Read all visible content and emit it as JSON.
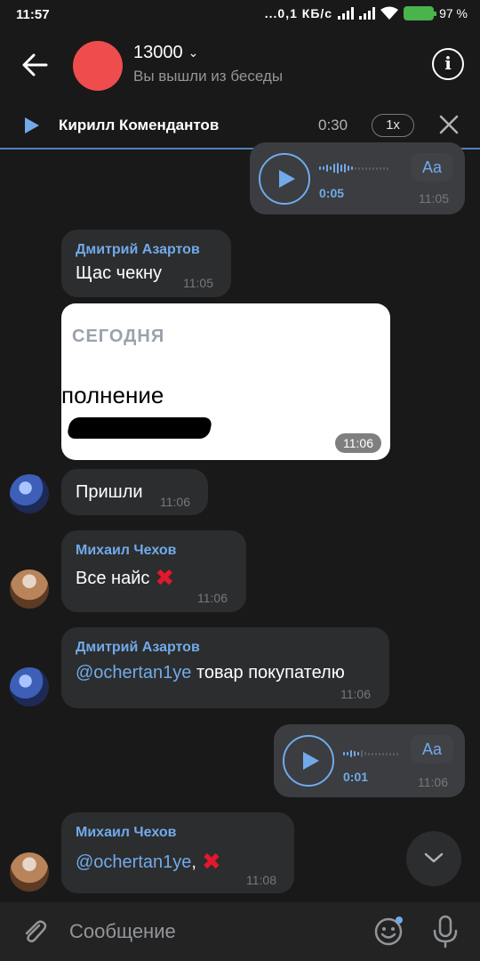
{
  "status": {
    "time": "11:57",
    "net": "...0,1 КБ/с",
    "battery": "97 %"
  },
  "header": {
    "title": "13000",
    "subtitle": "Вы вышли из беседы",
    "avatar_color": "#ef4d4d"
  },
  "player": {
    "name": "Кирилл Комендантов",
    "time": "0:30",
    "speed": "1x"
  },
  "messages": [
    {
      "type": "voice",
      "outgoing": true,
      "duration": "0:05",
      "time": "11:05",
      "aa": "Aa"
    },
    {
      "sender": "Дмитрий Азартов",
      "text": "Щас чекну",
      "time": "11:05"
    },
    {
      "type": "photo",
      "label": "СЕГОДНЯ",
      "text": "полнение",
      "time": "11:06"
    },
    {
      "text": "Пришли",
      "time": "11:06"
    },
    {
      "sender": "Михаил Чехов",
      "text": "Все найс",
      "emoji": "✖",
      "time": "11:06"
    },
    {
      "sender": "Дмитрий Азартов",
      "mention": "@ochertan1ye",
      "text": " товар покупателю",
      "time": "11:06"
    },
    {
      "type": "voice",
      "outgoing": true,
      "duration": "0:01",
      "time": "11:06",
      "aa": "Aa"
    },
    {
      "sender": "Михаил Чехов",
      "mention": "@ochertan1ye",
      "text": ",",
      "emoji": "✖",
      "time": "11:08"
    }
  ],
  "composer": {
    "placeholder": "Сообщение"
  },
  "colors": {
    "accent": "#71aaeb",
    "background": "#19191a",
    "bubble": "#2c2d2e",
    "error": "#e3182d"
  }
}
